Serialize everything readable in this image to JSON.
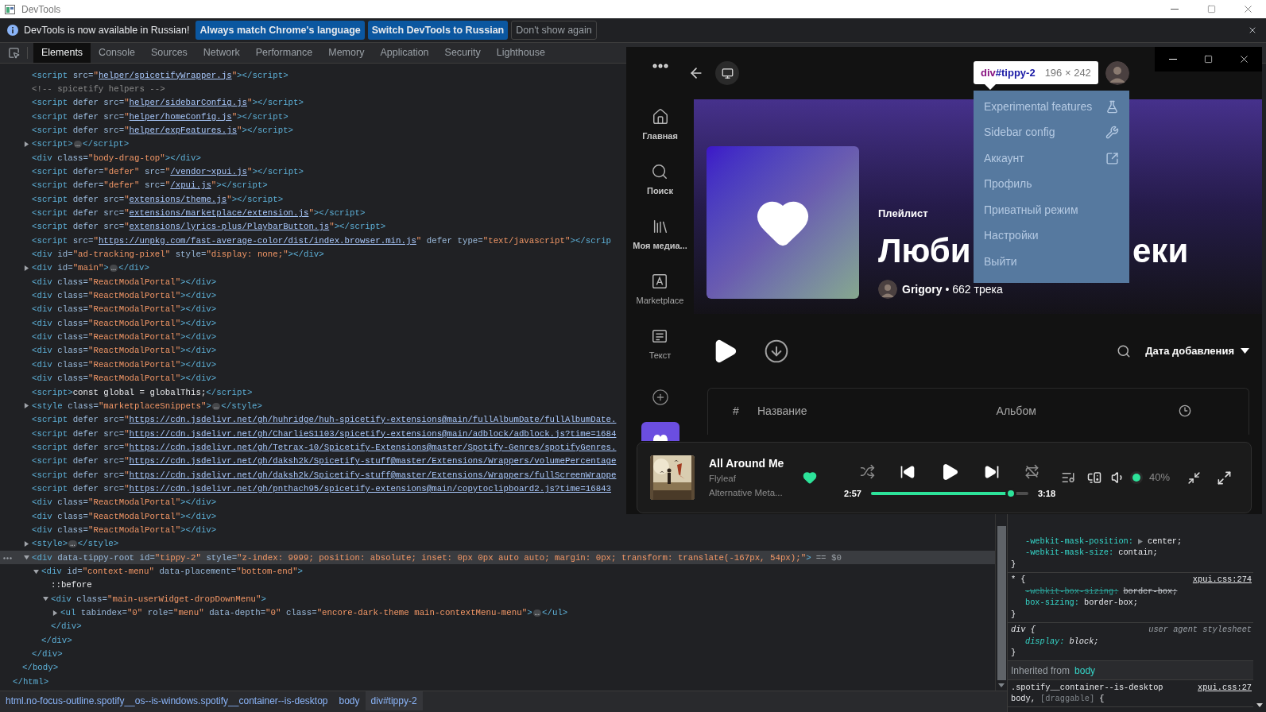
{
  "window": {
    "title": "DevTools"
  },
  "infobar": {
    "message": "DevTools is now available in Russian!",
    "buttons": [
      {
        "label": "Always match Chrome's language",
        "kind": "primary"
      },
      {
        "label": "Switch DevTools to Russian",
        "kind": "primary"
      },
      {
        "label": "Don't show again",
        "kind": "secondary"
      }
    ]
  },
  "tabs": [
    {
      "label": "Elements",
      "selected": true
    },
    {
      "label": "Console",
      "selected": false
    },
    {
      "label": "Sources",
      "selected": false
    },
    {
      "label": "Network",
      "selected": false
    },
    {
      "label": "Performance",
      "selected": false
    },
    {
      "label": "Memory",
      "selected": false
    },
    {
      "label": "Application",
      "selected": false
    },
    {
      "label": "Security",
      "selected": false
    },
    {
      "label": "Lighthouse",
      "selected": false
    }
  ],
  "dom_tree": [
    {
      "closing": "</html>",
      "children": [
        {
          "closing": "</body>",
          "children": [
            {
              "code": "<script src=\"helper/spicetifyWrapper.js\"></script>",
              "selected": false
            },
            {
              "code": "<!-- spicetify helpers -->",
              "selected": false
            },
            {
              "code": "<script defer src=\"helper/sidebarConfig.js\"></script>",
              "selected": false
            },
            {
              "code": "<script defer src=\"helper/homeConfig.js\"></script>",
              "selected": false
            },
            {
              "code": "<script defer src=\"helper/expFeatures.js\"></script>",
              "selected": false
            },
            {
              "code": "<script>…</script>",
              "expanded": false,
              "selected": false
            },
            {
              "code": "<div class=\"body-drag-top\"></div>",
              "selected": false
            },
            {
              "code": "<script defer=\"defer\" src=\"/vendor~xpui.js\"></script>",
              "selected": false
            },
            {
              "code": "<script defer=\"defer\" src=\"/xpui.js\"></script>",
              "selected": false
            },
            {
              "code": "<script defer src=\"extensions/theme.js\"></script>",
              "selected": false
            },
            {
              "code": "<script defer src=\"extensions/marketplace/extension.js\"></script>",
              "selected": false
            },
            {
              "code": "<script defer src=\"extensions/lyrics-plus/PlaybarButton.js\"></script>",
              "selected": false
            },
            {
              "code": "<script src=\"https://unpkg.com/fast-average-color/dist/index.browser.min.js\" defer type=\"text/javascript\"></scrip",
              "selected": false
            },
            {
              "code": "<div id=\"ad-tracking-pixel\" style=\"display: none;\"></div>",
              "selected": false
            },
            {
              "code": "<div id=\"main\">…</div>",
              "expanded": false,
              "selected": false
            },
            {
              "code": "<div class=\"ReactModalPortal\"></div>",
              "selected": false
            },
            {
              "code": "<div class=\"ReactModalPortal\"></div>",
              "selected": false
            },
            {
              "code": "<div class=\"ReactModalPortal\"></div>",
              "selected": false
            },
            {
              "code": "<div class=\"ReactModalPortal\"></div>",
              "selected": false
            },
            {
              "code": "<div class=\"ReactModalPortal\"></div>",
              "selected": false
            },
            {
              "code": "<div class=\"ReactModalPortal\"></div>",
              "selected": false
            },
            {
              "code": "<div class=\"ReactModalPortal\"></div>",
              "selected": false
            },
            {
              "code": "<div class=\"ReactModalPortal\"></div>",
              "selected": false
            },
            {
              "code": "<script>const global = globalThis;</script>",
              "selected": false
            },
            {
              "code": "<style class=\"marketplaceSnippets\">…</style>",
              "expanded": false,
              "selected": false
            },
            {
              "code": "<script defer src=\"https://cdn.jsdelivr.net/gh/huhridge/huh-spicetify-extensions@main/fullAlbumDate/fullAlbumDate.",
              "selected": false
            },
            {
              "code": "<script defer src=\"https://cdn.jsdelivr.net/gh/CharlieS1103/spicetify-extensions@main/adblock/adblock.js?time=1684",
              "selected": false
            },
            {
              "code": "<script defer src=\"https://cdn.jsdelivr.net/gh/Tetrax-10/Spicetify-Extensions@master/Spotify-Genres/spotifyGenres.",
              "selected": false
            },
            {
              "code": "<script defer src=\"https://cdn.jsdelivr.net/gh/daksh2k/Spicetify-stuff@master/Extensions/Wrappers/volumePercentage",
              "selected": false
            },
            {
              "code": "<script defer src=\"https://cdn.jsdelivr.net/gh/daksh2k/Spicetify-stuff@master/Extensions/Wrappers/fullScreenWrappe",
              "selected": false
            },
            {
              "code": "<script defer src=\"https://cdn.jsdelivr.net/gh/pnthach95/spicetify-extensions@main/copytoclipboard2.js?time=16843",
              "selected": false
            },
            {
              "code": "<div class=\"ReactModalPortal\"></div>",
              "selected": false
            },
            {
              "code": "<div class=\"ReactModalPortal\"></div>",
              "selected": false
            },
            {
              "code": "<div class=\"ReactModalPortal\"></div>",
              "selected": false
            },
            {
              "code": "<style>…</style>",
              "expanded": false,
              "selected": false
            },
            {
              "code": "<div data-tippy-root id=\"tippy-2\" style=\"z-index: 9999; position: absolute; inset: 0px 0px auto auto; margin: 0px; transform: translate(-167px, 54px);\">",
              "suffix": "== $0",
              "expanded": true,
              "selected": true,
              "closing": "</div>",
              "children": [
                {
                  "code": "<div id=\"context-menu\" data-placement=\"bottom-end\">",
                  "expanded": true,
                  "selected": false,
                  "closing": "</div>",
                  "children": [
                    {
                      "code": "::before",
                      "selected": false
                    },
                    {
                      "code": "<div class=\"main-userWidget-dropDownMenu\">",
                      "expanded": true,
                      "selected": false,
                      "closing": "</div>",
                      "children": [
                        {
                          "code": "<ul tabindex=\"0\" role=\"menu\" data-depth=\"0\" class=\"encore-dark-theme main-contextMenu-menu\">…</ul>",
                          "expanded": false,
                          "selected": false
                        }
                      ]
                    }
                  ]
                }
              ]
            }
          ]
        }
      ]
    }
  ],
  "breadcrumbs": [
    {
      "label": "html.no-focus-outline.spotify__os--is-windows.spotify__container--is-desktop",
      "selected": false
    },
    {
      "label": "body",
      "selected": false
    },
    {
      "label": "div#tippy-2",
      "selected": true
    }
  ],
  "styles": {
    "rules": [
      {
        "declarations": [
          {
            "property": "-webkit-mask-position:",
            "value": "center;",
            "expandable": true,
            "overridden": false
          },
          {
            "property": "-webkit-mask-size:",
            "value": "contain;",
            "overridden": false
          }
        ],
        "closing": "}"
      },
      {
        "selector_lines": [
          [
            {
              "text": "* {",
              "matched": true
            }
          ]
        ],
        "source": "xpui.css:274",
        "kind": "author",
        "declarations": [
          {
            "property": "-webkit-box-sizing:",
            "value": "border-box;",
            "overridden": true
          },
          {
            "property": "box-sizing:",
            "value": "border-box;",
            "overridden": false
          }
        ],
        "closing": "}"
      },
      {
        "selector_lines": [
          [
            {
              "text": "div {",
              "matched": true
            }
          ]
        ],
        "source": "user agent stylesheet",
        "kind": "user_agent",
        "declarations": [
          {
            "property": "display:",
            "value": "block;",
            "overridden": false
          }
        ],
        "closing": "}"
      }
    ],
    "inherited": {
      "label": "Inherited from",
      "element": "body"
    },
    "inherited_rules": [
      {
        "selector_lines": [
          [
            {
              "text": ".spotify__container--is-desktop",
              "matched": true
            }
          ],
          [
            {
              "text": "body,",
              "matched": true
            },
            {
              "text": "[draggable]",
              "matched": false
            },
            {
              "text": "{",
              "matched": true
            }
          ]
        ],
        "source": "xpui.css:27",
        "kind": "author"
      }
    ]
  },
  "spotify": {
    "nav": [
      {
        "label": "Главная",
        "kind": "builtin"
      },
      {
        "label": "Поиск",
        "kind": "builtin"
      },
      {
        "label": "Моя медиа...",
        "kind": "builtin"
      },
      {
        "label": "Marketplace",
        "kind": "custom_app"
      },
      {
        "label": "Текст",
        "kind": "custom_app"
      }
    ],
    "inspector_tooltip": {
      "tag": "div",
      "id": "#tippy-2",
      "size": "196 × 242"
    },
    "menu": [
      {
        "label": "Experimental features"
      },
      {
        "label": "Sidebar config"
      },
      {
        "label": "Аккаунт"
      },
      {
        "label": "Профиль"
      },
      {
        "label": "Приватный режим"
      },
      {
        "label": "Настройки"
      },
      {
        "label": "Выйти"
      }
    ],
    "playlist": {
      "type_label": "Плейлист",
      "title_parts": [
        "Люби",
        "еки"
      ],
      "owner_line": "**Grigory** • 662 трека"
    },
    "sort": {
      "label": "Дата добавления"
    },
    "table": {
      "columns": [
        "#",
        "Название",
        "Альбом"
      ]
    },
    "player": {
      "title": "All Around Me",
      "artist": "Flyleaf",
      "album": "Alternative Meta...",
      "liked": true,
      "elapsed": "2:57",
      "duration": "3:18",
      "progress": {
        "level": 0.89
      },
      "volume_label": "40%"
    }
  }
}
